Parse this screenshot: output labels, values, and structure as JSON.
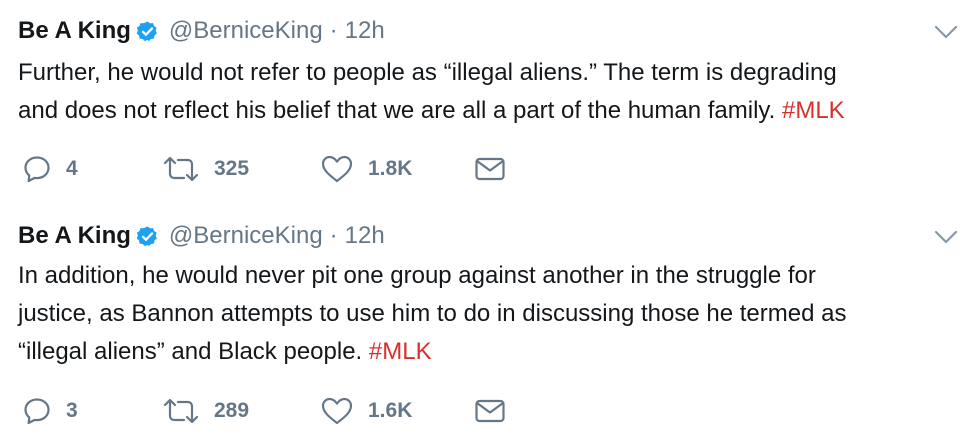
{
  "colors": {
    "text": "#14171a",
    "muted": "#657786",
    "verified": "#1da1f2",
    "hashtag": "#d9302c"
  },
  "tweets": [
    {
      "name": "Be A King",
      "handle": "@BerniceKing",
      "separator": "·",
      "time": "12h",
      "text_lines": [
        "Further, he would not refer to people as “illegal aliens.” The term is degrading",
        "and does not reflect his belief that we are all a part of the human family. "
      ],
      "hashtag": "#MLK",
      "replies": "4",
      "retweets": "325",
      "likes": "1.8K",
      "icons": [
        "verified-badge-icon",
        "chevron-down-icon",
        "reply-icon",
        "retweet-icon",
        "like-icon",
        "message-icon"
      ]
    },
    {
      "name": "Be A King",
      "handle": "@BerniceKing",
      "separator": "·",
      "time": "12h",
      "text_lines": [
        "In addition, he would never pit one group against another in the struggle for",
        "justice, as Bannon attempts to use him to do in discussing those he termed as",
        "“illegal aliens” and Black people. "
      ],
      "hashtag": "#MLK",
      "replies": "3",
      "retweets": "289",
      "likes": "1.6K",
      "icons": [
        "verified-badge-icon",
        "chevron-down-icon",
        "reply-icon",
        "retweet-icon",
        "like-icon",
        "message-icon"
      ]
    }
  ]
}
